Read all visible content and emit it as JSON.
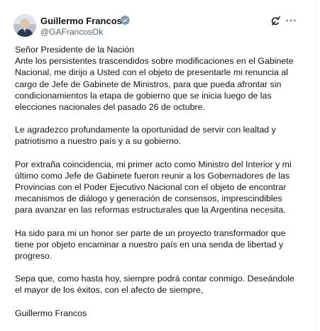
{
  "tweet": {
    "author_name": "Guillermo Francos",
    "author_handle": "@GAFrancosOk",
    "icons": [
      "avatar",
      "verified-badge-icon",
      "grok-icon",
      "more-options-icon"
    ],
    "paragraphs": [
      "Señor Presidente de la Nación",
      "Ante los persistentes trascendidos sobre modificaciones en el Gabinete",
      "Nacional, me dirijo a Usted con el objeto de presentarle mi renuncia al",
      "cargo de Jefe de Gabinete de Ministros, para que pueda afrontar sin",
      "condicionamientos la etapa de gobierno que se inicia luego de las",
      "elecciones nacionales del pasado 26 de octubre.",
      "Le agradezco profundamente la oportunidad de servir con lealtad y",
      "patriotismo a nuestro país y a su gobierno.",
      "Por extraña coincidencia, mi primer acto como Ministro del Interior y mi",
      "último como Jefe de Gabinete fueron reunir a los Gobernadores de las",
      "Provincias con el Poder Ejecutivo Nacional con el objeto de encontrar",
      "mecanismos de diálogo y generación de consensos, imprescindibles",
      "para avanzar en las reformas estructurales que la Argentina necesita.",
      "Ha sido para mi un honor ser parte de un proyecto transformador que",
      "tiene por objeto encaminar a nuestro país en una senda de libertad y",
      "progreso.",
      "Sepa que, como hasta hoy, siempre podrá contar conmigo. Deseándole",
      "el mayor de los éxitos, con el afecto de siempre,",
      "Guillermo Francos"
    ],
    "colors": {
      "text": "#0f1419",
      "secondary": "#536471",
      "verified": "#829aab"
    }
  }
}
